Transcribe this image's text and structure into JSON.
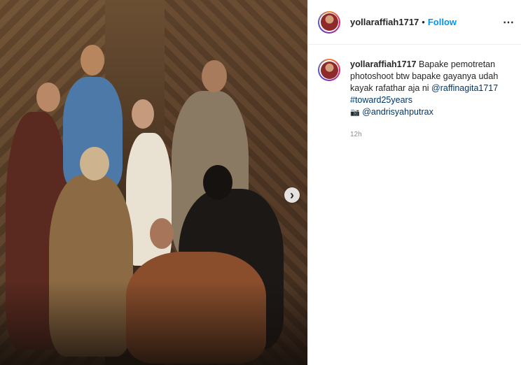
{
  "post": {
    "username": "yollaraffiah1717",
    "separator": "•",
    "follow_label": "Follow",
    "more_icon": "⋯",
    "next_icon": "›"
  },
  "caption": {
    "username": "yollaraffiah1717",
    "text": "Bapake pemotretan photoshoot btw bapake gayanya udah kayak rafathar aja ni ",
    "mention1": "@raffinagita1717",
    "hashtag": "#toward25years",
    "camera_icon": "📷",
    "mention2": "@andrisyahputrax"
  },
  "timestamp": "12h",
  "colors": {
    "follow": "#0095f6",
    "link": "#00376b",
    "muted": "#8e8e8e"
  }
}
